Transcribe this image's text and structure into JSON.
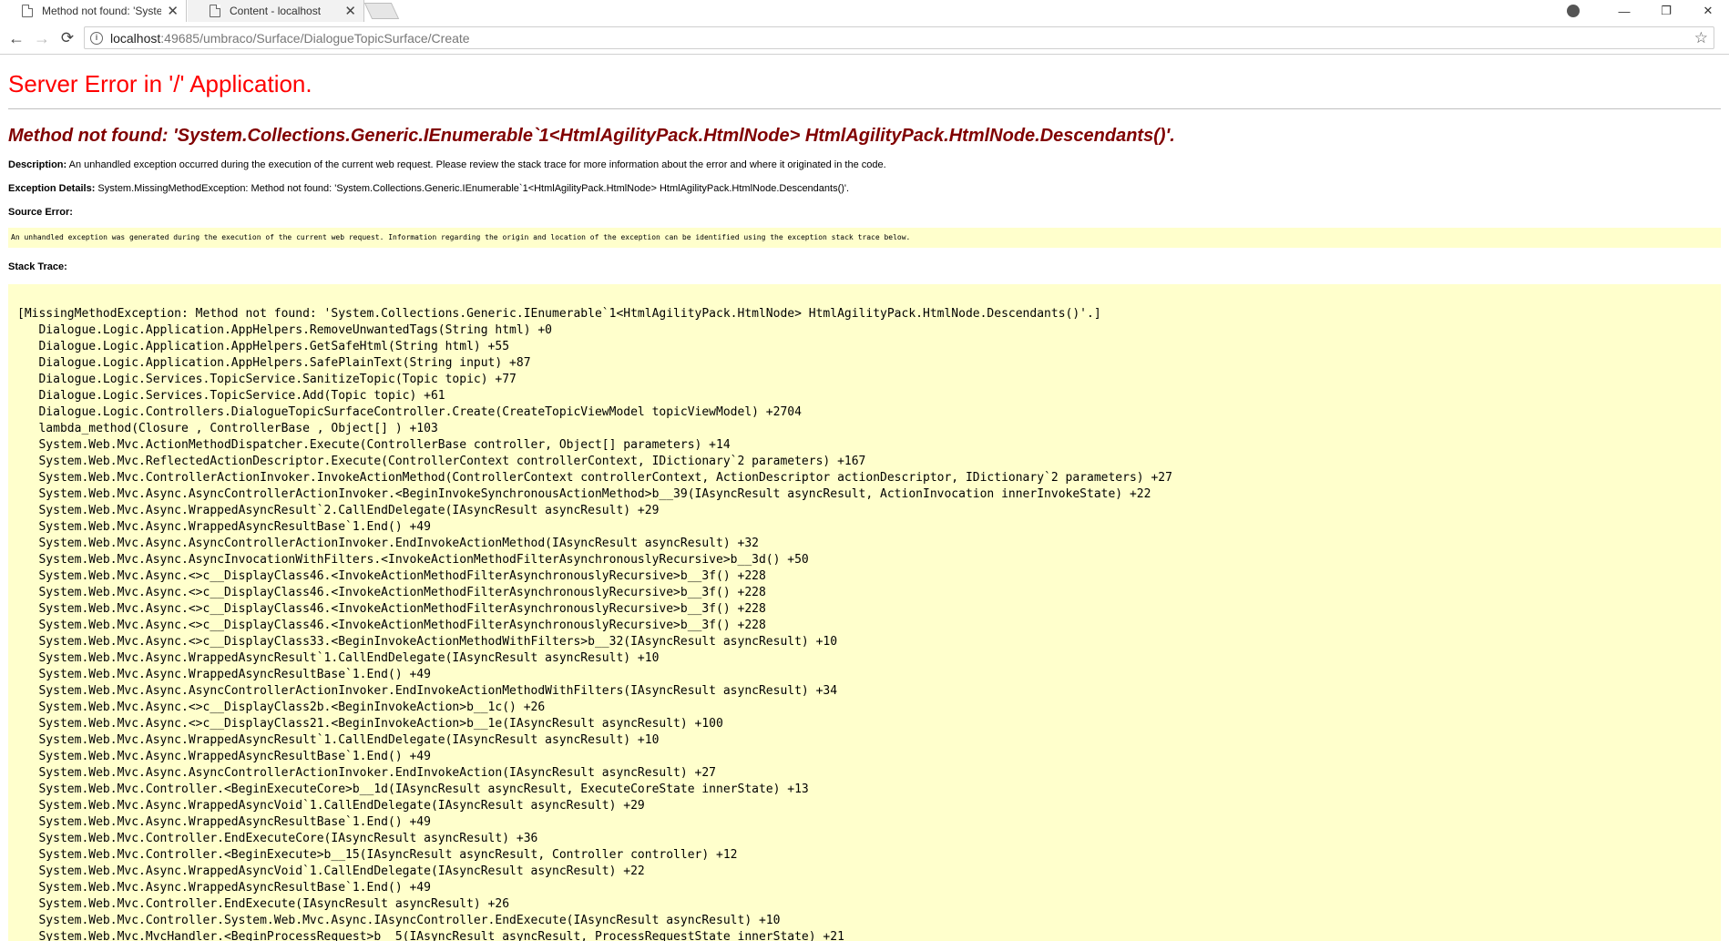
{
  "browser": {
    "tabs": [
      {
        "title": "Method not found: 'Syste",
        "active": true
      },
      {
        "title": "Content - localhost",
        "active": false
      }
    ],
    "url_host": "localhost",
    "url_path": ":49685/umbraco/Surface/DialogueTopicSurface/Create"
  },
  "page": {
    "title": "Server Error in '/' Application.",
    "error_message": "Method not found: 'System.Collections.Generic.IEnumerable`1<HtmlAgilityPack.HtmlNode> HtmlAgilityPack.HtmlNode.Descendants()'.",
    "description_label": "Description:",
    "description_text": "An unhandled exception occurred during the execution of the current web request. Please review the stack trace for more information about the error and where it originated in the code.",
    "exception_label": "Exception Details:",
    "exception_text": "System.MissingMethodException: Method not found: 'System.Collections.Generic.IEnumerable`1<HtmlAgilityPack.HtmlNode> HtmlAgilityPack.HtmlNode.Descendants()'.",
    "source_label": "Source Error:",
    "source_text": "An unhandled exception was generated during the execution of the current web request. Information regarding the origin and location of the exception can be identified using the exception stack trace below.",
    "stack_label": "Stack Trace:",
    "stack_head": "[MissingMethodException: Method not found: 'System.Collections.Generic.IEnumerable`1<HtmlAgilityPack.HtmlNode> HtmlAgilityPack.HtmlNode.Descendants()'.]",
    "stack_lines": [
      "Dialogue.Logic.Application.AppHelpers.RemoveUnwantedTags(String html) +0",
      "Dialogue.Logic.Application.AppHelpers.GetSafeHtml(String html) +55",
      "Dialogue.Logic.Application.AppHelpers.SafePlainText(String input) +87",
      "Dialogue.Logic.Services.TopicService.SanitizeTopic(Topic topic) +77",
      "Dialogue.Logic.Services.TopicService.Add(Topic topic) +61",
      "Dialogue.Logic.Controllers.DialogueTopicSurfaceController.Create(CreateTopicViewModel topicViewModel) +2704",
      "lambda_method(Closure , ControllerBase , Object[] ) +103",
      "System.Web.Mvc.ActionMethodDispatcher.Execute(ControllerBase controller, Object[] parameters) +14",
      "System.Web.Mvc.ReflectedActionDescriptor.Execute(ControllerContext controllerContext, IDictionary`2 parameters) +167",
      "System.Web.Mvc.ControllerActionInvoker.InvokeActionMethod(ControllerContext controllerContext, ActionDescriptor actionDescriptor, IDictionary`2 parameters) +27",
      "System.Web.Mvc.Async.AsyncControllerActionInvoker.<BeginInvokeSynchronousActionMethod>b__39(IAsyncResult asyncResult, ActionInvocation innerInvokeState) +22",
      "System.Web.Mvc.Async.WrappedAsyncResult`2.CallEndDelegate(IAsyncResult asyncResult) +29",
      "System.Web.Mvc.Async.WrappedAsyncResultBase`1.End() +49",
      "System.Web.Mvc.Async.AsyncControllerActionInvoker.EndInvokeActionMethod(IAsyncResult asyncResult) +32",
      "System.Web.Mvc.Async.AsyncInvocationWithFilters.<InvokeActionMethodFilterAsynchronouslyRecursive>b__3d() +50",
      "System.Web.Mvc.Async.<>c__DisplayClass46.<InvokeActionMethodFilterAsynchronouslyRecursive>b__3f() +228",
      "System.Web.Mvc.Async.<>c__DisplayClass46.<InvokeActionMethodFilterAsynchronouslyRecursive>b__3f() +228",
      "System.Web.Mvc.Async.<>c__DisplayClass46.<InvokeActionMethodFilterAsynchronouslyRecursive>b__3f() +228",
      "System.Web.Mvc.Async.<>c__DisplayClass46.<InvokeActionMethodFilterAsynchronouslyRecursive>b__3f() +228",
      "System.Web.Mvc.Async.<>c__DisplayClass33.<BeginInvokeActionMethodWithFilters>b__32(IAsyncResult asyncResult) +10",
      "System.Web.Mvc.Async.WrappedAsyncResult`1.CallEndDelegate(IAsyncResult asyncResult) +10",
      "System.Web.Mvc.Async.WrappedAsyncResultBase`1.End() +49",
      "System.Web.Mvc.Async.AsyncControllerActionInvoker.EndInvokeActionMethodWithFilters(IAsyncResult asyncResult) +34",
      "System.Web.Mvc.Async.<>c__DisplayClass2b.<BeginInvokeAction>b__1c() +26",
      "System.Web.Mvc.Async.<>c__DisplayClass21.<BeginInvokeAction>b__1e(IAsyncResult asyncResult) +100",
      "System.Web.Mvc.Async.WrappedAsyncResult`1.CallEndDelegate(IAsyncResult asyncResult) +10",
      "System.Web.Mvc.Async.WrappedAsyncResultBase`1.End() +49",
      "System.Web.Mvc.Async.AsyncControllerActionInvoker.EndInvokeAction(IAsyncResult asyncResult) +27",
      "System.Web.Mvc.Controller.<BeginExecuteCore>b__1d(IAsyncResult asyncResult, ExecuteCoreState innerState) +13",
      "System.Web.Mvc.Async.WrappedAsyncVoid`1.CallEndDelegate(IAsyncResult asyncResult) +29",
      "System.Web.Mvc.Async.WrappedAsyncResultBase`1.End() +49",
      "System.Web.Mvc.Controller.EndExecuteCore(IAsyncResult asyncResult) +36",
      "System.Web.Mvc.Controller.<BeginExecute>b__15(IAsyncResult asyncResult, Controller controller) +12",
      "System.Web.Mvc.Async.WrappedAsyncVoid`1.CallEndDelegate(IAsyncResult asyncResult) +22",
      "System.Web.Mvc.Async.WrappedAsyncResultBase`1.End() +49",
      "System.Web.Mvc.Controller.EndExecute(IAsyncResult asyncResult) +26",
      "System.Web.Mvc.Controller.System.Web.Mvc.Async.IAsyncController.EndExecute(IAsyncResult asyncResult) +10",
      "System.Web.Mvc.MvcHandler.<BeginProcessRequest>b__5(IAsyncResult asyncResult, ProcessRequestState innerState) +21"
    ]
  }
}
